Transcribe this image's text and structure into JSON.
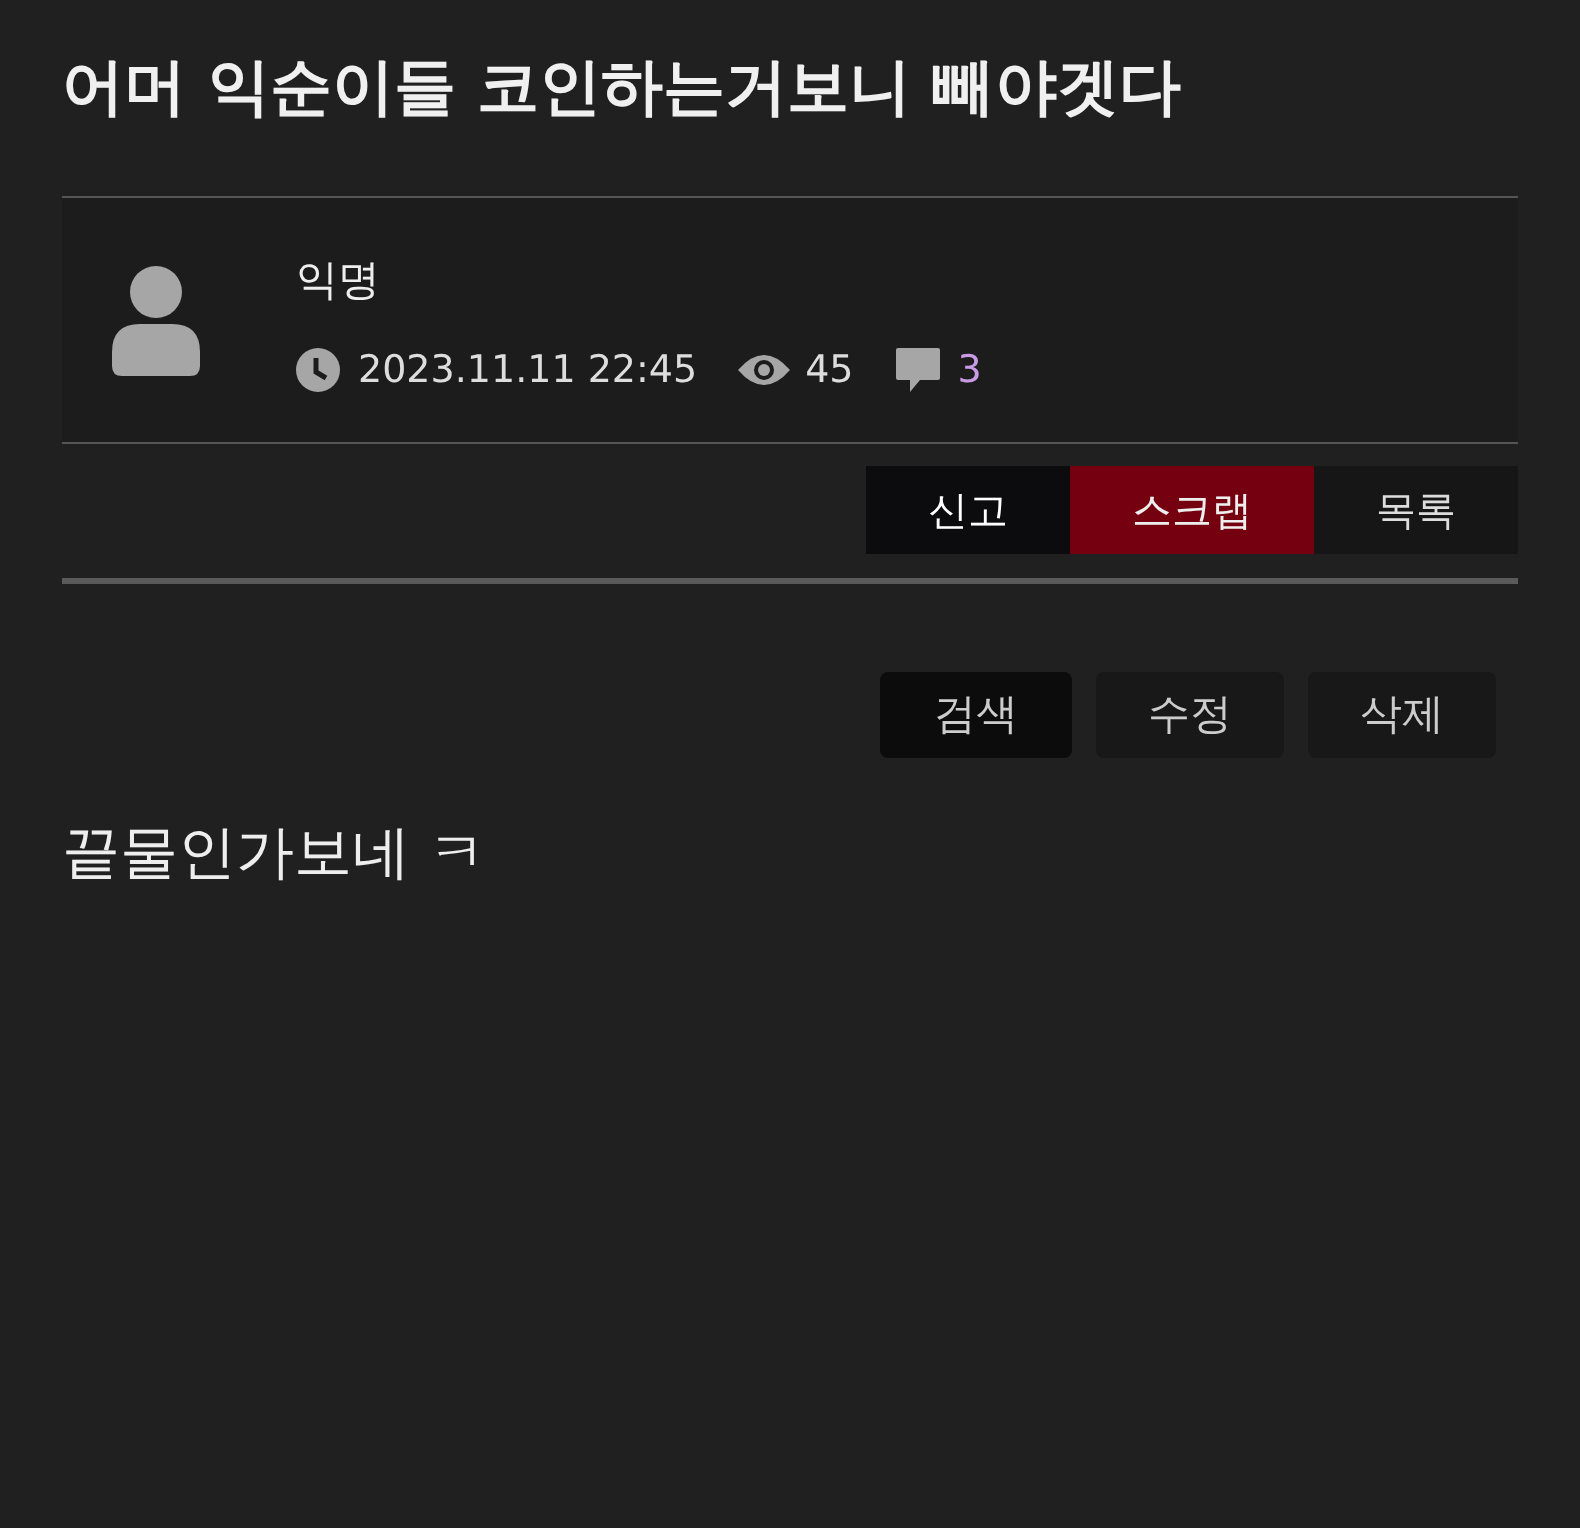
{
  "title": "어머 익순이들 코인하는거보니 빼야겟다",
  "author": {
    "name": "익명",
    "datetime": "2023.11.11 22:45",
    "views": "45",
    "comments": "3"
  },
  "post_actions": [
    {
      "label": "신고",
      "kind": "dark"
    },
    {
      "label": "스크랩",
      "kind": "accent"
    },
    {
      "label": "목록",
      "kind": "plain"
    }
  ],
  "tools": [
    {
      "label": "검색",
      "kind": "dark"
    },
    {
      "label": "수정",
      "kind": "plain"
    },
    {
      "label": "삭제",
      "kind": "plain"
    }
  ],
  "body": "끝물인가보네 ㅋ"
}
